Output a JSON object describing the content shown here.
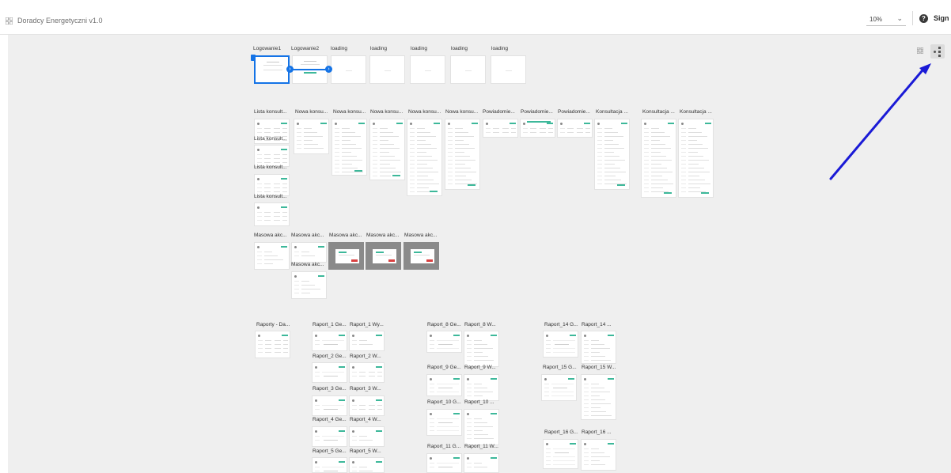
{
  "header": {
    "app_title": "Doradcy Energetyczni v1.0",
    "zoom_value": "10%",
    "help_symbol": "?",
    "signin_label": "Sign In"
  },
  "colors": {
    "accent": "#1473e6",
    "annotation_arrow": "#1a1ad6",
    "canvas_bg": "#efefef"
  },
  "icons": {
    "app": "grid-icon",
    "zoom": "chevron-down-icon",
    "help": "help-icon",
    "grid_view": "grid-view-icon",
    "flow_view": "flow-view-icon"
  },
  "artboards": [
    {
      "label": "Logowanie1",
      "selected": true
    },
    {
      "label": "Logowanie2"
    },
    {
      "label": "loading"
    },
    {
      "label": "loading"
    },
    {
      "label": "loading"
    },
    {
      "label": "loading"
    },
    {
      "label": "loading"
    },
    {
      "label": "Lista konsult..."
    },
    {
      "label": "Nowa konsu..."
    },
    {
      "label": "Nowa konsu..."
    },
    {
      "label": "Nowa konsu..."
    },
    {
      "label": "Nowa konsu..."
    },
    {
      "label": "Nowa konsu..."
    },
    {
      "label": "Powiadomie..."
    },
    {
      "label": "Powiadomie..."
    },
    {
      "label": "Powiadomie..."
    },
    {
      "label": "Konsultacja ..."
    },
    {
      "label": "Konsultacja ..."
    },
    {
      "label": "Konsultacja ..."
    },
    {
      "label": "Lista konsult..."
    },
    {
      "label": "Lista konsult..."
    },
    {
      "label": "Lista konsult..."
    },
    {
      "label": "Masowa akc..."
    },
    {
      "label": "Masowa akc..."
    },
    {
      "label": "Masowa akc..."
    },
    {
      "label": "Masowa akc..."
    },
    {
      "label": "Masowa akc..."
    },
    {
      "label": "Masowa akc..."
    },
    {
      "label": "Raporty - Da..."
    },
    {
      "label": "Raport_1 Ge..."
    },
    {
      "label": "Raport_1 Wy..."
    },
    {
      "label": "Raport_2 Ge..."
    },
    {
      "label": "Raport_2 W..."
    },
    {
      "label": "Raport_3 Ge..."
    },
    {
      "label": "Raport_3 W..."
    },
    {
      "label": "Raport_4 Ge..."
    },
    {
      "label": "Raport_4 W..."
    },
    {
      "label": "Raport_5 Ge..."
    },
    {
      "label": "Raport_5 W..."
    },
    {
      "label": "Raport_8 Ge..."
    },
    {
      "label": "Raport_8 W..."
    },
    {
      "label": "Raport_9 Ge..."
    },
    {
      "label": "Raport_9 W..."
    },
    {
      "label": "Raport_10 G..."
    },
    {
      "label": "Raport_10 ..."
    },
    {
      "label": "Raport_11 G..."
    },
    {
      "label": "Raport_11 W..."
    },
    {
      "label": "Raport_14 G..."
    },
    {
      "label": "Raport_14 ..."
    },
    {
      "label": "Raport_15 G..."
    },
    {
      "label": "Raport_15 W..."
    },
    {
      "label": "Raport_16 G..."
    },
    {
      "label": "Raport_16 ..."
    }
  ]
}
